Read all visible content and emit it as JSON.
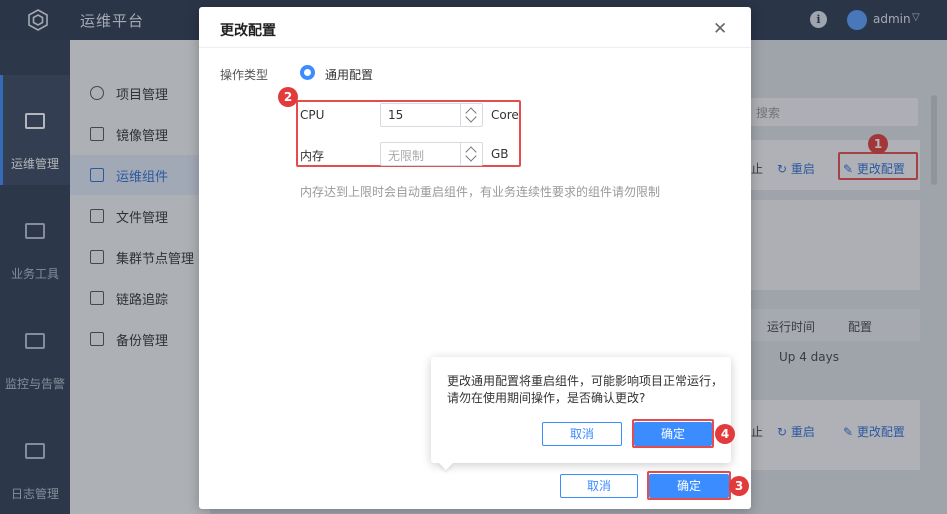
{
  "topbar": {
    "app_title": "运维平台",
    "info_icon": "info-icon",
    "user_name": "admin"
  },
  "rail": [
    {
      "label": "运维管理",
      "icon": "monitor-icon"
    },
    {
      "label": "业务工具",
      "icon": "code-window-icon"
    },
    {
      "label": "监控与告警",
      "icon": "monitor-pulse-icon"
    },
    {
      "label": "日志管理",
      "icon": "calendar-icon"
    }
  ],
  "subnav": [
    {
      "label": "项目管理",
      "icon": "gear-icon"
    },
    {
      "label": "镜像管理",
      "icon": "ship-icon"
    },
    {
      "label": "运维组件",
      "icon": "cluster-icon"
    },
    {
      "label": "文件管理",
      "icon": "file-icon"
    },
    {
      "label": "集群节点管理",
      "icon": "sliders-icon"
    },
    {
      "label": "链路追踪",
      "icon": "route-icon"
    },
    {
      "label": "备份管理",
      "icon": "backup-icon"
    }
  ],
  "background": {
    "search_placeholder": "搜索",
    "restart_label": "重启",
    "change_config_label": "更改配置",
    "table_headers": [
      "运行时间",
      "配置"
    ],
    "uptime_value": "Up 4 days",
    "partial_char": "止"
  },
  "modal": {
    "title": "更改配置",
    "op_type_label": "操作类型",
    "radio_label": "通用配置",
    "cpu_label": "CPU",
    "cpu_value": "15",
    "cpu_unit": "Core",
    "memory_label": "内存",
    "memory_placeholder": "无限制",
    "memory_unit": "GB",
    "hint": "内存达到上限时会自动重启组件，有业务连续性要求的组件请勿限制",
    "cancel_label": "取消",
    "confirm_label": "确定"
  },
  "popconfirm": {
    "text": "更改通用配置将重启组件，可能影响项目正常运行，请勿在使用期间操作，是否确认更改?",
    "cancel_label": "取消",
    "confirm_label": "确定"
  },
  "badges": [
    "1",
    "2",
    "3",
    "4"
  ],
  "colors": {
    "accent": "#3b8cff",
    "highlight": "#e34d4d",
    "topbar": "#2b3a52"
  }
}
